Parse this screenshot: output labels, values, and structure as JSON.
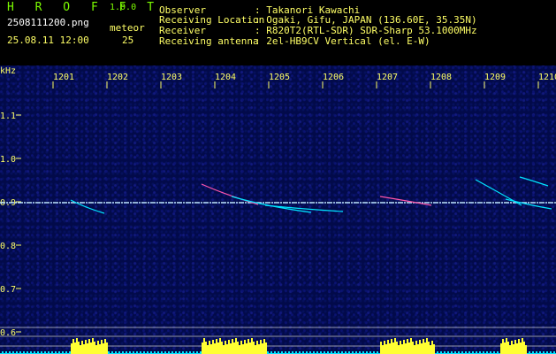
{
  "header": {
    "brand": "H R O F F T",
    "version": "1.0.0",
    "filename": "2508111200.png",
    "date_time": "25.08.11 12:00",
    "meteor_label": "meteor",
    "meteor_count": "25",
    "info": [
      {
        "key": "Observer",
        "value": ": Takanori Kawachi"
      },
      {
        "key": "Receiving Location",
        "value": ": Ogaki, Gifu, JAPAN (136.60E, 35.35N)"
      },
      {
        "key": "Receiver",
        "value": ": R820T2(RTL-SDR) SDR-Sharp 53.1000MHz"
      },
      {
        "key": "Receiving antenna",
        "value": ": 2el-HB9CV Vertical (el. E-W)"
      }
    ]
  },
  "axes": {
    "y_unit": "kHz",
    "x_ticks": [
      "1201",
      "1202",
      "1203",
      "1204",
      "1205",
      "1206",
      "1207",
      "1208",
      "1209",
      "1210"
    ],
    "y_ticks": [
      "1.1",
      "1.0",
      "0.9",
      "0.8",
      "0.7",
      "0.6"
    ]
  },
  "colors": {
    "green": "#7cfc00",
    "yellow": "#ffff66",
    "bg": "#020a4a",
    "carrier": "#bfe8ff",
    "signal": "#00e5ff"
  }
}
